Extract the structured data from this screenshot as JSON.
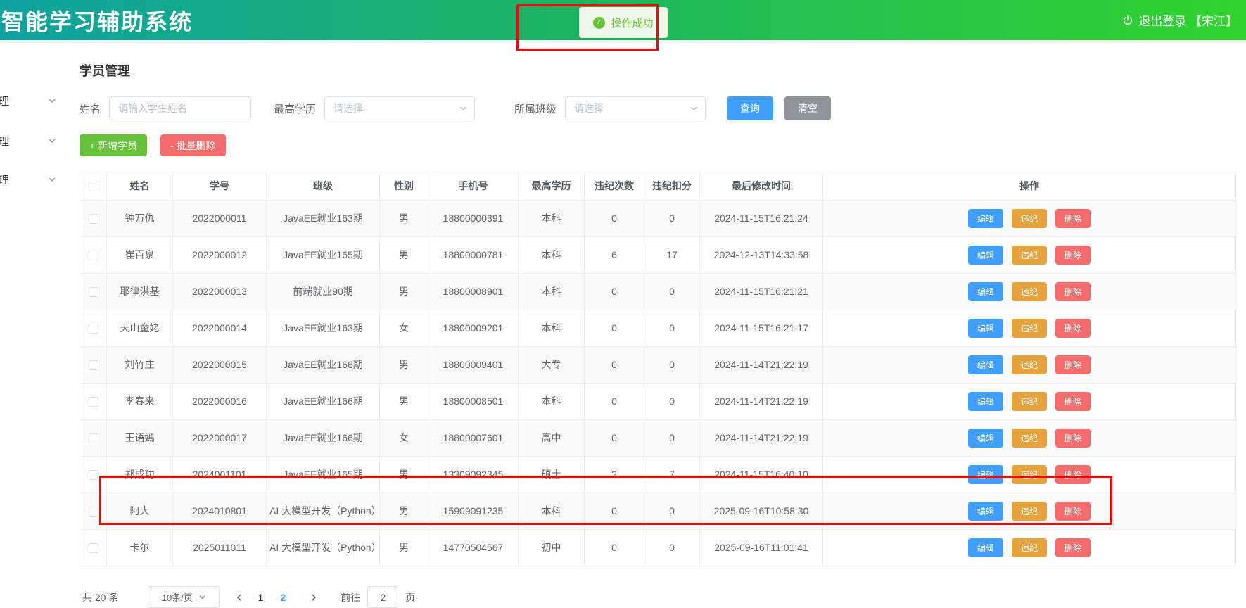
{
  "header": {
    "title": "智能学习辅助系统",
    "logout_label": "退出登录 【宋江】",
    "toast_text": "操作成功"
  },
  "sidebar": {
    "items": [
      {
        "label": "理"
      },
      {
        "label": "理"
      },
      {
        "label": "理"
      }
    ]
  },
  "main": {
    "page_title": "学员管理",
    "filters": {
      "name_label": "姓名",
      "name_placeholder": "请输入学生姓名",
      "name_value": "",
      "education_label": "最高学历",
      "education_placeholder": "请选择",
      "class_label": "所属班级",
      "class_placeholder": "请选择",
      "search_button": "查询",
      "clear_button": "清空"
    },
    "actions": {
      "add_button": "+ 新增学员",
      "batch_delete_button": "- 批量删除"
    },
    "table": {
      "headers": [
        "姓名",
        "学号",
        "班级",
        "性别",
        "手机号",
        "最高学历",
        "违纪次数",
        "违纪扣分",
        "最后修改时间",
        "操作"
      ],
      "row_actions": {
        "edit": "编辑",
        "violation": "违纪",
        "delete": "删除"
      },
      "rows": [
        {
          "name": "钟万仇",
          "student_id": "2022000011",
          "class_name": "JavaEE就业163期",
          "gender": "男",
          "phone": "18800000391",
          "education": "本科",
          "violations": "0",
          "points": "0",
          "modified": "2024-11-15T16:21:24"
        },
        {
          "name": "崔百泉",
          "student_id": "2022000012",
          "class_name": "JavaEE就业165期",
          "gender": "男",
          "phone": "18800000781",
          "education": "本科",
          "violations": "6",
          "points": "17",
          "modified": "2024-12-13T14:33:58"
        },
        {
          "name": "耶律洪基",
          "student_id": "2022000013",
          "class_name": "前端就业90期",
          "gender": "男",
          "phone": "18800008901",
          "education": "本科",
          "violations": "0",
          "points": "0",
          "modified": "2024-11-15T16:21:21"
        },
        {
          "name": "天山童姥",
          "student_id": "2022000014",
          "class_name": "JavaEE就业163期",
          "gender": "女",
          "phone": "18800009201",
          "education": "本科",
          "violations": "0",
          "points": "0",
          "modified": "2024-11-15T16:21:17"
        },
        {
          "name": "刘竹庄",
          "student_id": "2022000015",
          "class_name": "JavaEE就业166期",
          "gender": "男",
          "phone": "18800009401",
          "education": "大专",
          "violations": "0",
          "points": "0",
          "modified": "2024-11-14T21:22:19"
        },
        {
          "name": "李春来",
          "student_id": "2022000016",
          "class_name": "JavaEE就业166期",
          "gender": "男",
          "phone": "18800008501",
          "education": "本科",
          "violations": "0",
          "points": "0",
          "modified": "2024-11-14T21:22:19"
        },
        {
          "name": "王语嫣",
          "student_id": "2022000017",
          "class_name": "JavaEE就业166期",
          "gender": "女",
          "phone": "18800007601",
          "education": "高中",
          "violations": "0",
          "points": "0",
          "modified": "2024-11-14T21:22:19"
        },
        {
          "name": "郑成功",
          "student_id": "2024001101",
          "class_name": "JavaEE就业165期",
          "gender": "男",
          "phone": "13309092345",
          "education": "硕士",
          "violations": "2",
          "points": "7",
          "modified": "2024-11-15T16:40:10"
        },
        {
          "name": "阿大",
          "student_id": "2024010801",
          "class_name": "AI 大模型开发（Python）",
          "gender": "男",
          "phone": "15909091235",
          "education": "本科",
          "violations": "0",
          "points": "0",
          "modified": "2025-09-16T10:58:30"
        },
        {
          "name": "卡尔",
          "student_id": "2025011011",
          "class_name": "AI 大模型开发（Python）",
          "gender": "男",
          "phone": "14770504567",
          "education": "初中",
          "violations": "0",
          "points": "0",
          "modified": "2025-09-16T11:01:41"
        }
      ]
    },
    "pagination": {
      "total_label": "共 20 条",
      "page_size_label": "10条/页",
      "pages": [
        "1",
        "2"
      ],
      "active_page": "2",
      "goto_label": "前往",
      "goto_value": "2",
      "page_suffix": "页"
    }
  },
  "colors": {
    "header_gradient_start": "#0fa2a0",
    "header_gradient_end": "#32d32f",
    "primary_blue": "#409eff",
    "success_green": "#67c23a",
    "warning_orange": "#e6a23c",
    "danger_red": "#f56c6c",
    "neutral_gray": "#909399",
    "annotation_red": "#f40606"
  }
}
